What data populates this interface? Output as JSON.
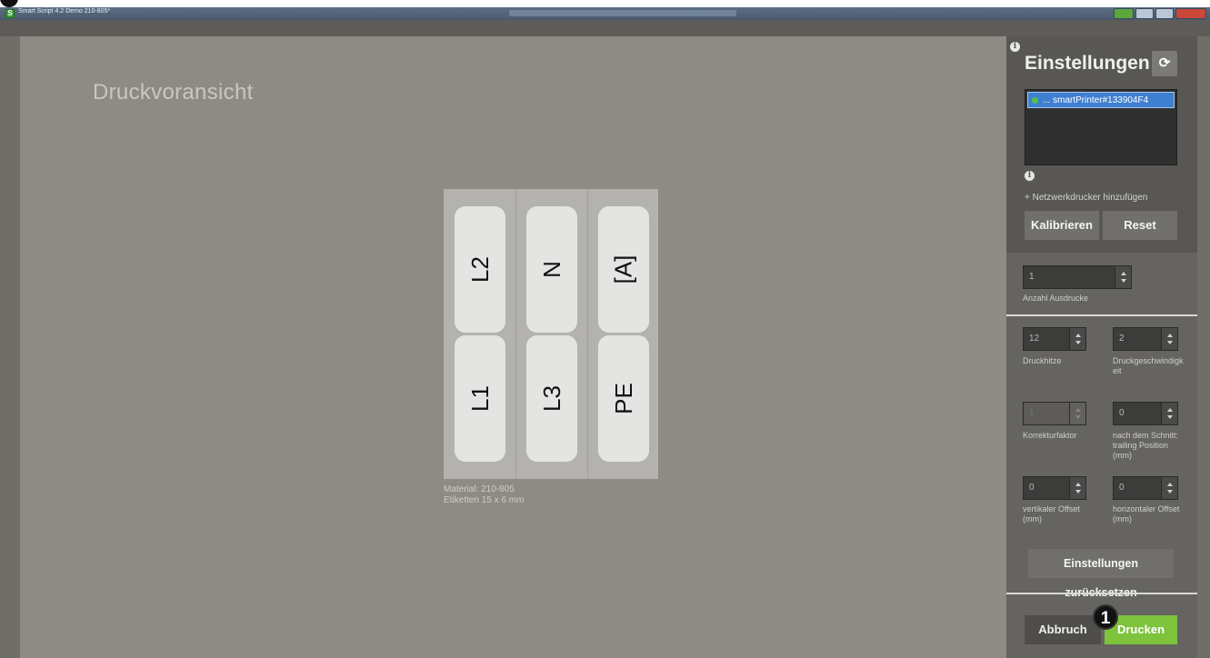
{
  "window": {
    "title": "Smart Script 4.2  Demo 210-805*"
  },
  "dialog": {
    "title": "Druckvoransicht"
  },
  "sheet": {
    "labels": [
      {
        "text": "L2"
      },
      {
        "text": "N"
      },
      {
        "text": "[A]"
      },
      {
        "text": "L1"
      },
      {
        "text": "L3"
      },
      {
        "text": "PE"
      }
    ],
    "material": "Material: 210-805",
    "label_size": "Etiketten  15 x 6 mm"
  },
  "settings": {
    "heading": "Einstellungen",
    "printer": "... smartPrinter#133904F4",
    "add_network": "+ Netzwerkdrucker hinzufügen",
    "calibrate": "Kalibrieren",
    "reset": "Reset",
    "prints": {
      "value": "1",
      "label": "Anzahl Ausdrucke"
    },
    "heat": {
      "value": "12",
      "label": "Druckhitze"
    },
    "speed": {
      "value": "2",
      "label": "Druckgeschwindigkeit"
    },
    "correction": {
      "value": "1",
      "label": "Korrekturfaktor"
    },
    "trailing": {
      "value": "0",
      "label": "nach dem Schnitt: trailing Position (mm)"
    },
    "v_offset": {
      "value": "0",
      "label": "vertikaler Offset (mm)"
    },
    "h_offset": {
      "value": "0",
      "label": "horizontaler Offset (mm)"
    },
    "reset_settings": "Einstellungen zurücksetzen",
    "cancel": "Abbruch",
    "print": "Drucken"
  },
  "badge": "1",
  "colors": {
    "accent_green": "#7ec33c",
    "selection_blue": "#3f7fcf"
  }
}
